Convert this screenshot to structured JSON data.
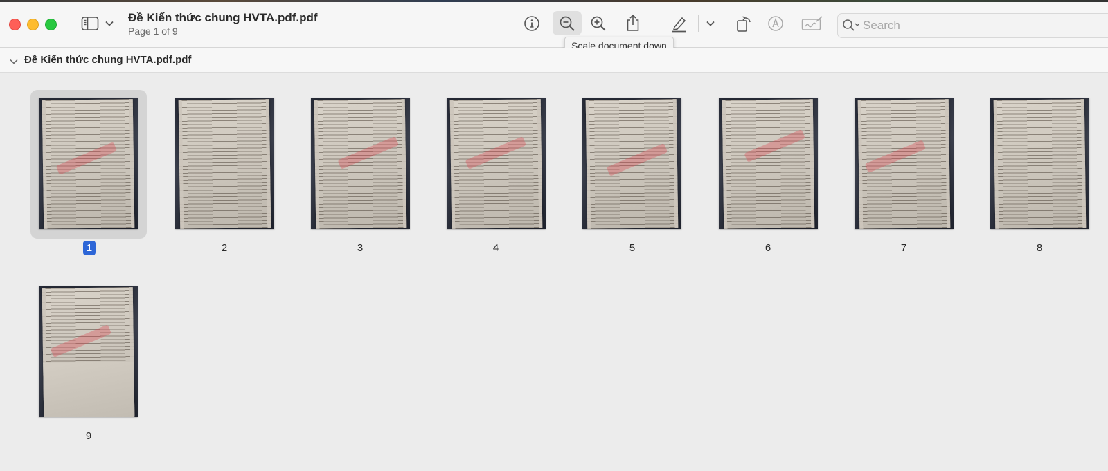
{
  "window": {
    "title": "Đề Kiến thức chung HVTA.pdf.pdf",
    "subtitle": "Page 1 of 9"
  },
  "toolbar": {
    "icons": [
      "sidebar-icon",
      "chevron-down-icon",
      "info-icon",
      "zoom-out-icon",
      "zoom-in-icon",
      "share-icon",
      "highlight-pen-icon",
      "chevron-down-icon",
      "rotate-icon",
      "markup-icon",
      "sign-icon",
      "search-icon"
    ],
    "search_placeholder": "Search",
    "tooltip": "Scale document down"
  },
  "document": {
    "name": "Đề Kiến thức chung HVTA.pdf.pdf",
    "selected_page": "1",
    "pages": [
      "1",
      "2",
      "3",
      "4",
      "5",
      "6",
      "7",
      "8",
      "9"
    ]
  },
  "colors": {
    "selection": "#2d66d7",
    "close": "#fe5f57",
    "minimize": "#febc2e",
    "zoom": "#28c840"
  }
}
